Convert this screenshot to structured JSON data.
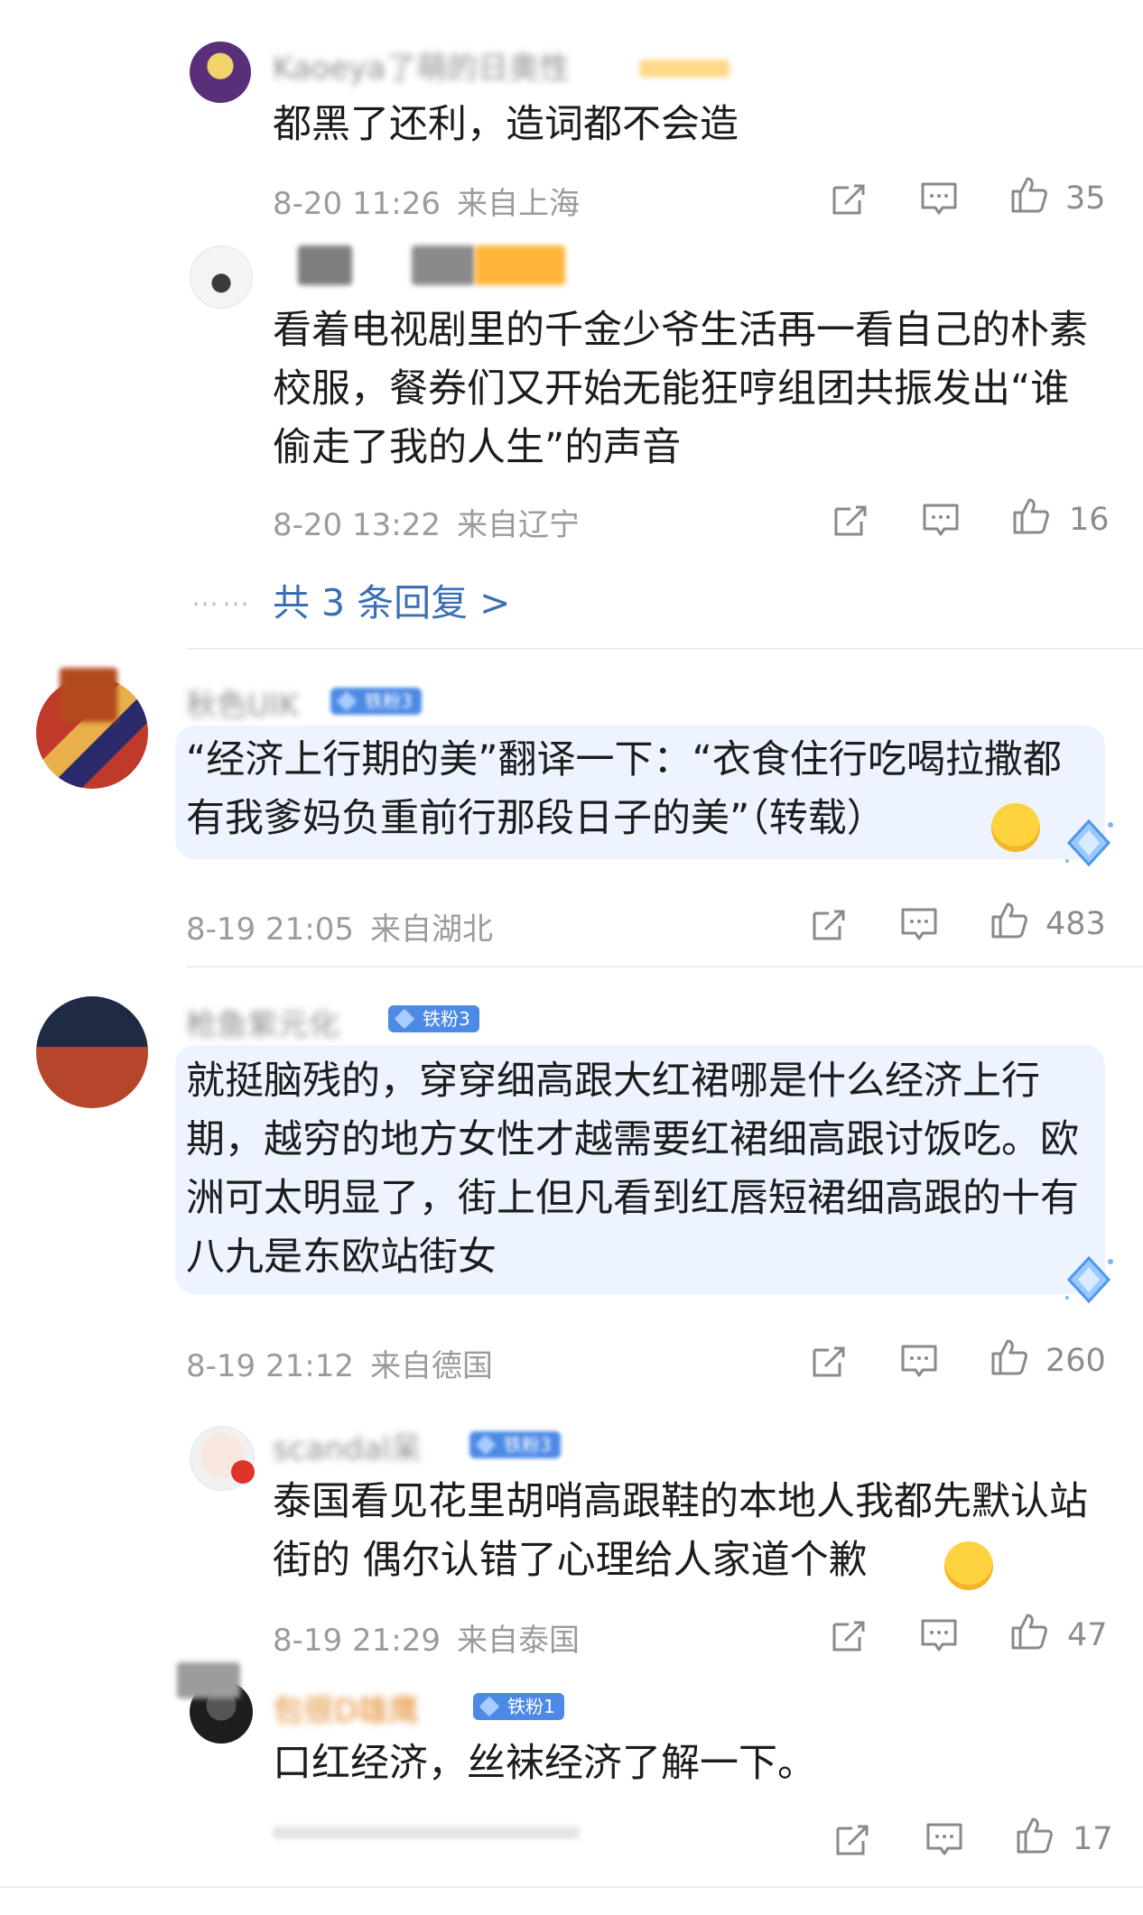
{
  "comments": [
    {
      "name": "Kaoeya了萌的日奥性",
      "text": "都黑了还利，造词都不会造",
      "date": "8-20 11:26",
      "location": "来自上海",
      "likes": "35"
    },
    {
      "text": "看着电视剧里的千金少爷生活再一看自己的朴素校服，餐券们又开始无能狂哼组团共振发出“谁偷走了我的人生”的声音",
      "date": "8-20 13:22",
      "location": "来自辽宁",
      "likes": "16"
    },
    {
      "more_replies": "共 3 条回复 >",
      "dots": "……"
    },
    {
      "name": "秋色UIK",
      "badge": "铁粉3",
      "text": "“经济上行期的美”翻译一下：“衣食住行吃喝拉撒都有我爹妈负重前行那段日子的美”（转载）",
      "date": "8-19 21:05",
      "location": "来自湖北",
      "likes": "483"
    },
    {
      "name": "枪鱼紫元化",
      "badge": "铁粉3",
      "text": "就挺脑残的，穿穿细高跟大红裙哪是什么经济上行期，越穷的地方女性才越需要红裙细高跟讨饭吃。欧洲可太明显了，街上但凡看到红唇短裙细高跟的十有八九是东欧站街女",
      "date": "8-19 21:12",
      "location": "来自德国",
      "likes": "260"
    },
    {
      "name": "scandal呆",
      "badge": "铁粉3",
      "text": "泰国看见花里胡哨高跟鞋的本地人我都先默认站街的 偶尔认错了心理给人家道个歉",
      "date": "8-19 21:29",
      "location": "来自泰国",
      "likes": "47"
    },
    {
      "name": "包很D雄鹰",
      "badge": "铁粉1",
      "text": "口红经济，丝袜经济了解一下。",
      "likes": "17"
    }
  ],
  "icons": {
    "share": "share-icon",
    "comment": "comment-icon",
    "like": "thumb-up-icon"
  },
  "colors": {
    "link": "#3b6fb4",
    "meta": "#9b9b9b",
    "highlight": "#edf3ff",
    "badge": "#4d8ae6"
  }
}
